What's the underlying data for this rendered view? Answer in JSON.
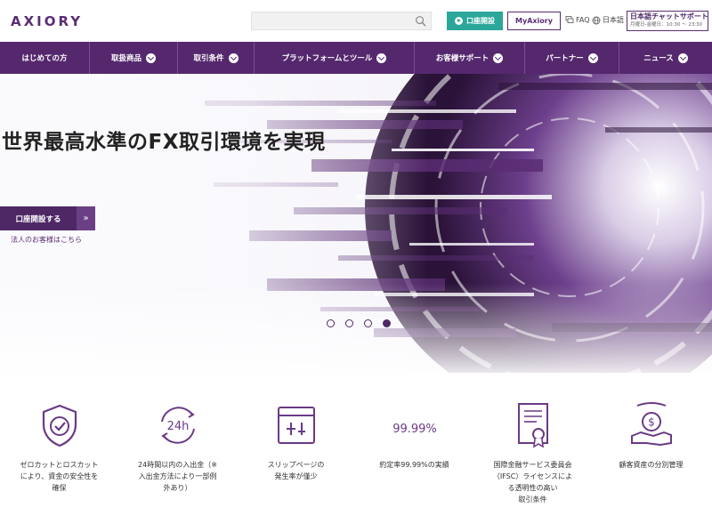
{
  "header": {
    "logo_text": "AXIORY",
    "search_placeholder": "",
    "open_account_label": "口座開設",
    "my_axiory_label": "MyAxiory",
    "faq_label": "FAQ",
    "language_label": "日本語",
    "chat_support_title": "日本語チャットサポート",
    "chat_support_hours": "月曜日-金曜日：10:30 ～ 23:30"
  },
  "nav": {
    "items": [
      {
        "label": "はじめての方",
        "has_dropdown": false
      },
      {
        "label": "取扱商品",
        "has_dropdown": true
      },
      {
        "label": "取引条件",
        "has_dropdown": true
      },
      {
        "label": "プラットフォームとツール",
        "has_dropdown": true
      },
      {
        "label": "お客様サポート",
        "has_dropdown": true
      },
      {
        "label": "パートナー",
        "has_dropdown": true
      },
      {
        "label": "ニュース",
        "has_dropdown": true
      }
    ]
  },
  "hero": {
    "title": "世界最高水準のFX取引環境を実現",
    "cta_label": "口座開設する",
    "cta_arrow": "»",
    "corporate_link": "法人のお客様はこちら",
    "carousel_slide_count": 4,
    "carousel_active_index": 4
  },
  "features": [
    {
      "icon": "shield-check-icon",
      "label": "ゼロカットとロスカット\nにより、資金の安全性を\n確保"
    },
    {
      "icon": "24h-clock-icon",
      "label": "24時間以内の入出金（※\n入出金方法により一部例\n外あり）"
    },
    {
      "icon": "slippage-calculator-icon",
      "label": "スリップページの\n発生率が僅少"
    },
    {
      "icon": "execution-rate-icon",
      "icon_text": "99.99%",
      "label": "約定率99.99%の実績"
    },
    {
      "icon": "certificate-icon",
      "label": "国際金融サービス委員会\n（IFSC）ライセンスによ\nる透明性の高い\n取引条件"
    },
    {
      "icon": "segregated-funds-icon",
      "label": "顧客資産の分別管理"
    }
  ],
  "colors": {
    "brand_purple": "#55286e",
    "accent_teal": "#2aa79a",
    "icon_purple": "#6a3a86"
  }
}
